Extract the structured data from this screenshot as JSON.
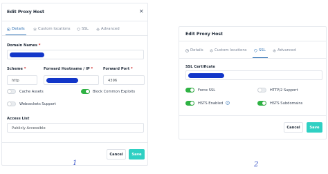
{
  "dialog1": {
    "title": "Edit Proxy Host",
    "tabs": [
      {
        "label": "Details",
        "icon": "target-icon",
        "active": true
      },
      {
        "label": "Custom locations",
        "icon": "layers-icon",
        "active": false
      },
      {
        "label": "SSL",
        "icon": "shield-icon",
        "active": false
      },
      {
        "label": "Advanced",
        "icon": "gear-icon",
        "active": false
      }
    ],
    "domain_names_label": "Domain Names",
    "scheme_label": "Scheme",
    "scheme_value": "http",
    "forward_host_label": "Forward Hostname / IP",
    "forward_port_label": "Forward Port",
    "forward_port_value": "4396",
    "cache_assets_label": "Cache Assets",
    "cache_assets_on": false,
    "block_exploits_label": "Block Common Exploits",
    "block_exploits_on": true,
    "websockets_label": "Websockets Support",
    "websockets_on": false,
    "access_list_label": "Access List",
    "access_list_value": "Publicly Accessible",
    "cancel_label": "Cancel",
    "save_label": "Save",
    "required_mark": "*"
  },
  "dialog2": {
    "title": "Edit Proxy Host",
    "tabs": [
      {
        "label": "Details",
        "icon": "target-icon",
        "active": false
      },
      {
        "label": "Custom locations",
        "icon": "layers-icon",
        "active": false
      },
      {
        "label": "SSL",
        "icon": "shield-icon",
        "active": true
      },
      {
        "label": "Advanced",
        "icon": "gear-icon",
        "active": false
      }
    ],
    "ssl_certificate_label": "SSL Certificate",
    "force_ssl_label": "Force SSL",
    "force_ssl_on": true,
    "http2_label": "HTTP/2 Support",
    "http2_on": false,
    "hsts_enabled_label": "HSTS Enabled",
    "hsts_enabled_on": true,
    "hsts_subdomains_label": "HSTS Subdomains",
    "hsts_subdomains_on": true,
    "cancel_label": "Cancel",
    "save_label": "Save"
  },
  "annotations": {
    "left": "1",
    "right": "2"
  },
  "colors": {
    "accent": "#2f71b4",
    "toggle_on": "#2fb344",
    "save_button": "#2fd0c3",
    "redaction": "#1236c9",
    "required": "#cd201f"
  }
}
